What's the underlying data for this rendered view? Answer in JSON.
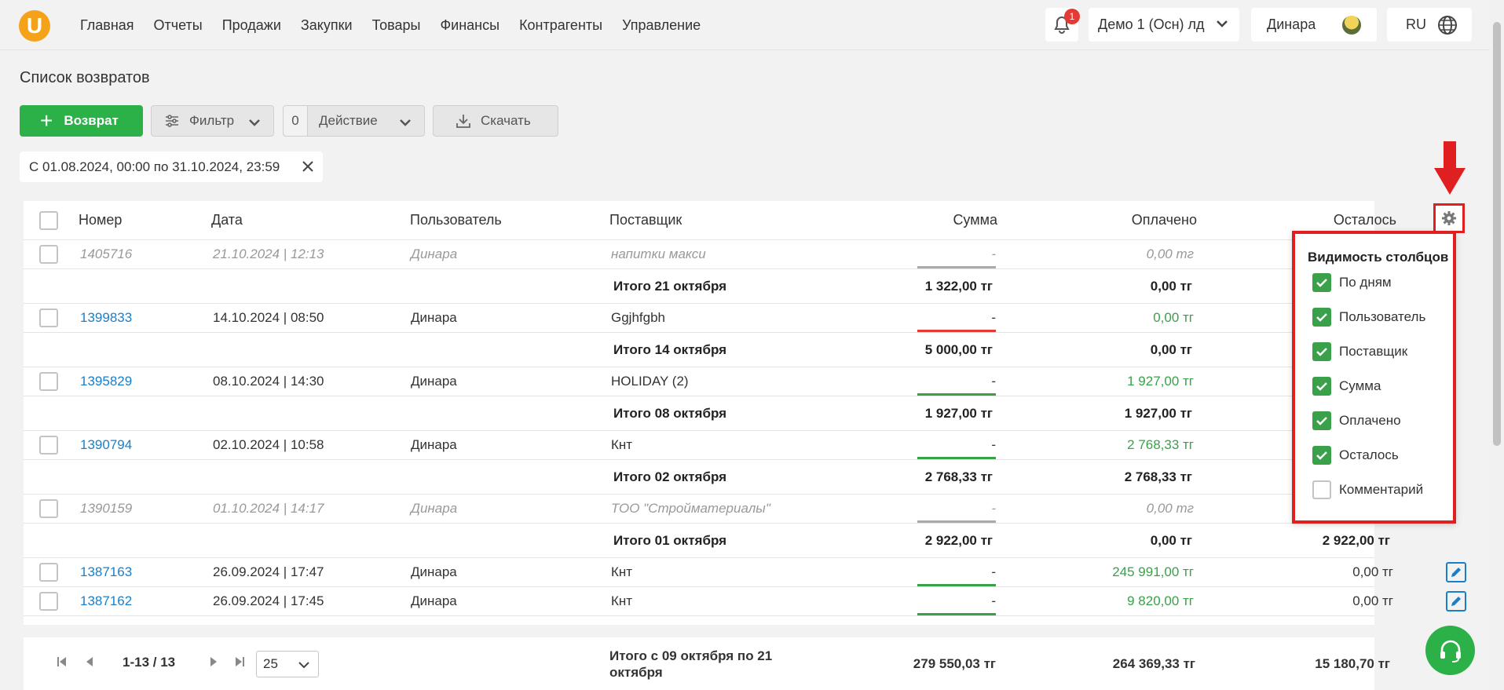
{
  "nav": {
    "logo": "U",
    "items": [
      "Главная",
      "Отчеты",
      "Продажи",
      "Закупки",
      "Товары",
      "Финансы",
      "Контрагенты",
      "Управление"
    ],
    "notifications_count": "1",
    "company": "Демо 1 (Осн) лд",
    "user": "Динара",
    "language": "RU"
  },
  "page": {
    "title": "Список возвратов"
  },
  "toolbar": {
    "add_label": "Возврат",
    "filter_label": "Фильтр",
    "action_count": "0",
    "action_label": "Действие",
    "download_label": "Скачать"
  },
  "filter_chip": "С 01.08.2024, 00:00 по 31.10.2024, 23:59",
  "table": {
    "headers": {
      "number": "Номер",
      "date": "Дата",
      "user": "Пользователь",
      "supplier": "Поставщик",
      "sum": "Сумма",
      "paid": "Оплачено",
      "remaining": "Осталось"
    },
    "rows": [
      {
        "number": "1405716",
        "date": "21.10.2024 | 12:13",
        "user": "Динара",
        "supplier": "напитки макси",
        "sum": "-",
        "paid": "0,00 тг",
        "muted": true
      },
      {
        "total": "Итого 21 октября",
        "sum": "1 322,00 тг",
        "paid": "0,00 тг"
      },
      {
        "number": "1399833",
        "date": "14.10.2024 | 08:50",
        "user": "Динара",
        "supplier": "Ggjhfgbh",
        "sum": "-",
        "paid": "0,00 тг"
      },
      {
        "total": "Итого 14 октября",
        "sum": "5 000,00 тг",
        "paid": "0,00 тг"
      },
      {
        "number": "1395829",
        "date": "08.10.2024 | 14:30",
        "user": "Динара",
        "supplier": "HOLIDAY (2)",
        "sum": "-",
        "paid": "1 927,00 тг"
      },
      {
        "total": "Итого 08 октября",
        "sum": "1 927,00 тг",
        "paid": "1 927,00 тг"
      },
      {
        "number": "1390794",
        "date": "02.10.2024 | 10:58",
        "user": "Динара",
        "supplier": "Кнт",
        "sum": "-",
        "paid": "2 768,33 тг"
      },
      {
        "total": "Итого 02 октября",
        "sum": "2 768,33 тг",
        "paid": "2 768,33 тг"
      },
      {
        "number": "1390159",
        "date": "01.10.2024 | 14:17",
        "user": "Динара",
        "supplier": "ТОО \"Стройматериалы\"",
        "sum": "-",
        "paid": "0,00 тг",
        "muted": true
      },
      {
        "total": "Итого 01 октября",
        "sum": "2 922,00 тг",
        "paid": "0,00 тг",
        "remaining": "2 922,00 тг"
      },
      {
        "number": "1387163",
        "date": "26.09.2024 | 17:47",
        "user": "Динара",
        "supplier": "Кнт",
        "sum": "-",
        "paid": "245 991,00 тг",
        "remaining": "0,00 тг"
      },
      {
        "number": "1387162",
        "date": "26.09.2024 | 17:45",
        "user": "Динара",
        "supplier": "Кнт",
        "sum": "-",
        "paid": "9 820,00 тг",
        "remaining": "0,00 тг"
      }
    ]
  },
  "column_visibility": {
    "title": "Видимость столбцов",
    "items": [
      {
        "label": "По дням",
        "checked": true
      },
      {
        "label": "Пользователь",
        "checked": true
      },
      {
        "label": "Поставщик",
        "checked": true
      },
      {
        "label": "Сумма",
        "checked": true
      },
      {
        "label": "Оплачено",
        "checked": true
      },
      {
        "label": "Осталось",
        "checked": true
      },
      {
        "label": "Комментарий",
        "checked": false
      }
    ]
  },
  "footer": {
    "range": "1-13 / 13",
    "per_page": "25",
    "total_label": "Итого с 09 октября по 21 октября",
    "sum": "279 550,03 тг",
    "paid": "264 369,33 тг",
    "remaining": "15 180,70 тг"
  },
  "colors": {
    "accent_green": "#2cb149",
    "link_blue": "#1a7fc8",
    "highlight_red": "#e02020"
  }
}
